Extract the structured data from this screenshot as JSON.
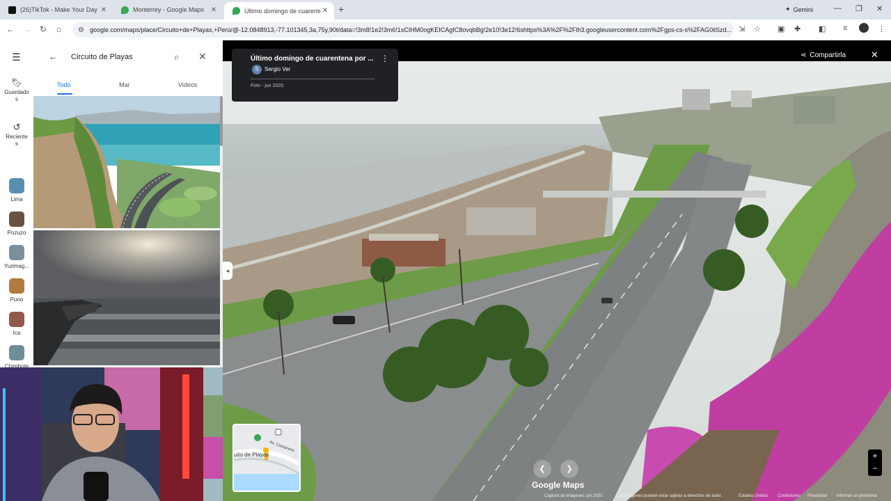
{
  "tabs": [
    {
      "title": "(26)TikTok - Make Your Day",
      "icon": "tiktok-icon"
    },
    {
      "title": "Monterrey - Google Maps",
      "icon": "maps-pin-icon"
    },
    {
      "title": "Último domingo de cuarenten",
      "icon": "maps-pin-icon"
    }
  ],
  "new_tab_label": "+",
  "gemini_label": "Gemini",
  "url": "google.com/maps/place/Circuito+de+Playas,+Perú/@-12.0848913,-77.101345,3a,75y,90t/data=!3m8!1e2!3m6!1sCIHM0ogKEICAgIC8ovqbBg!2e10!3e12!6shttps%3A%2F%2Flh3.googleusercontent.com%2Fgps-cs-s%2FAG0ilSzd...",
  "rail": {
    "saved_label": "Guardado\ns",
    "recent_label": "Reciente\ns",
    "places": [
      {
        "label": "Lima",
        "color": "#5a8fb0"
      },
      {
        "label": "Pozuzo",
        "color": "#6b5240"
      },
      {
        "label": "Yurimag...",
        "color": "#7d8f9a"
      },
      {
        "label": "Puno",
        "color": "#b07a40"
      },
      {
        "label": "Ica",
        "color": "#8f5a4a"
      },
      {
        "label": "Chimbote",
        "color": "#6f8f98"
      }
    ]
  },
  "search": {
    "query": "Circuito de Playas"
  },
  "panel_tabs": {
    "all": "Todo",
    "sea": "Mar",
    "videos": "Videos"
  },
  "photo": {
    "title": "Último domingo de cuarentena por ...",
    "author": "Sergio Ver",
    "author_initial": "S",
    "meta": "Foto - jun 2020"
  },
  "share_label": "Compartirla",
  "minimap_labels": {
    "road": "Av. Costanera",
    "beach": "uito de Playas"
  },
  "brand": "Google Maps",
  "footer": {
    "capture": "Captura de imágenes: jun 2020",
    "rights": "Las imágenes pueden estar sujetas a derechos de autor.",
    "country": "Estados Unidos",
    "terms": "Condiciones",
    "privacy": "Privacidad",
    "report": "Informar un problema"
  },
  "colors": {
    "accent": "#1a73e8",
    "tabbar": "#dee3eb"
  }
}
